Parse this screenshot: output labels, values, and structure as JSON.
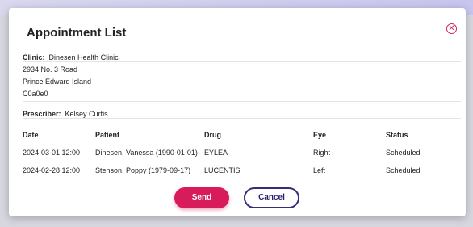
{
  "dialog": {
    "title": "Appointment List",
    "close_icon": "close-circle-icon"
  },
  "clinic": {
    "label": "Clinic:",
    "name": "Dinesen Health Clinic",
    "address1": "2934 No. 3 Road",
    "address2": "Prince Edward Island",
    "postal": "C0a0e0"
  },
  "prescriber": {
    "label": "Prescriber:",
    "name": "Kelsey Curtis"
  },
  "table": {
    "headers": [
      "Date",
      "Patient",
      "Drug",
      "Eye",
      "Status"
    ],
    "rows": [
      [
        "2024-03-01 12:00",
        "Dinesen, Vanessa (1990-01-01)",
        "EYLEA",
        "Right",
        "Scheduled"
      ],
      [
        "2024-02-28 12:00",
        "Stenson, Poppy (1979-09-17)",
        "LUCENTIS",
        "Left",
        "Scheduled"
      ]
    ]
  },
  "buttons": {
    "send": "Send",
    "cancel": "Cancel"
  },
  "colors": {
    "accent": "#d81b5b",
    "secondary": "#3a2a7a"
  }
}
